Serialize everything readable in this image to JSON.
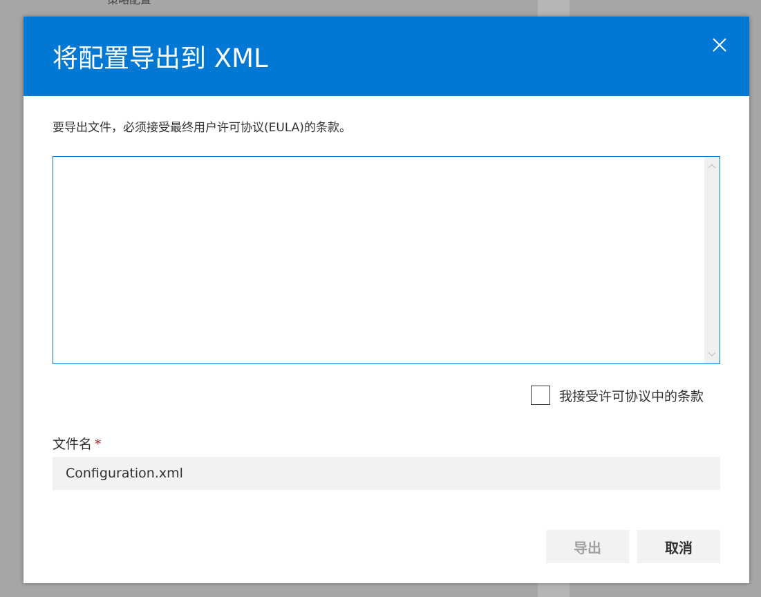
{
  "background": {
    "peek_text": "策略配置"
  },
  "dialog": {
    "title": "将配置导出到 XML",
    "close_icon": "close-icon",
    "instruction": "要导出文件，必须接受最终用户许可协议(EULA)的条款。",
    "eula_text": "",
    "accept_checkbox": {
      "label": "我接受许可协议中的条款",
      "checked": false
    },
    "filename": {
      "label": "文件名",
      "required_marker": "*",
      "value": "Configuration.xml"
    },
    "buttons": {
      "export_label": "导出",
      "export_enabled": false,
      "cancel_label": "取消"
    }
  },
  "colors": {
    "header": "#0078d4",
    "required": "#a4262c",
    "input_bg": "#f3f2f1",
    "disabled_text": "#a19f9d"
  }
}
